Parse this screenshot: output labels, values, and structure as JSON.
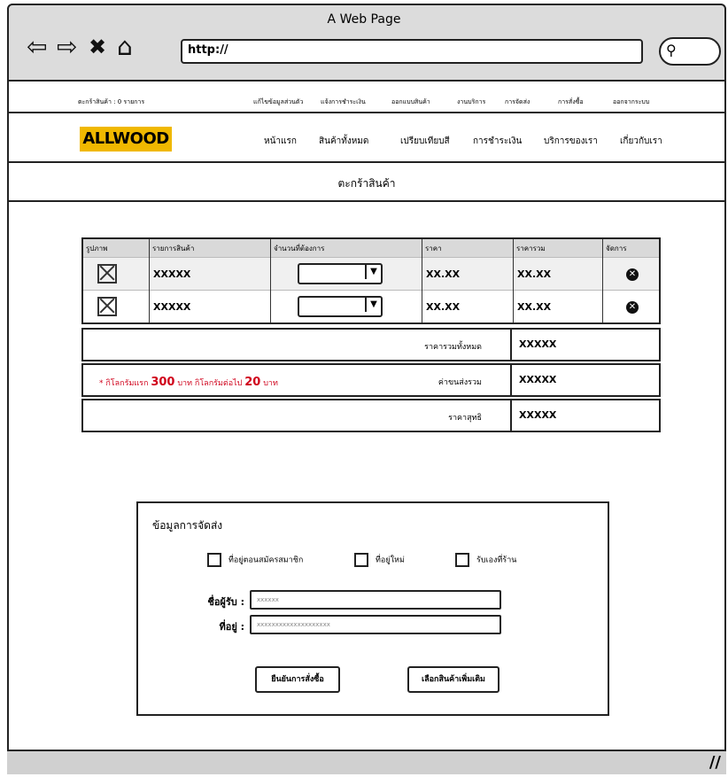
{
  "window": {
    "title": "A Web Page",
    "url": "http://"
  },
  "toplinks": {
    "cart": "ตะกร้าสินค้า : 0 รายการ",
    "items": [
      "แก้ไขข้อมูลส่วนตัว",
      "แจ้งการชำระเงิน",
      "ออกแบบสินค้า",
      "งานบริการ",
      "การจัดส่ง",
      "การสั่งซื้อ",
      "ออกจากระบบ"
    ]
  },
  "brand": {
    "logo": "ALLWOOD"
  },
  "nav": {
    "items": [
      "หน้าแรก",
      "สินค้าทั้งหมด",
      "เปรียบเทียบสี",
      "การชำระเงิน",
      "บริการของเรา",
      "เกี่ยวกับเรา"
    ]
  },
  "page": {
    "heading": "ตะกร้าสินค้า"
  },
  "cart": {
    "headers": [
      "รูปภาพ",
      "รายการสินค้า",
      "จำนวนที่ต้องการ",
      "ราคา",
      "ราคารวม",
      "จัดการ"
    ],
    "rows": [
      {
        "name": "XXXXX",
        "price": "XX.XX",
        "total": "XX.XX"
      },
      {
        "name": "XXXXX",
        "price": "XX.XX",
        "total": "XX.XX"
      }
    ],
    "summary": [
      {
        "label": "ราคารวมทั้งหมด",
        "value": "XXXXX"
      },
      {
        "label": "ค่าขนส่งรวม",
        "value": "XXXXX"
      },
      {
        "label": "ราคาสุทธิ",
        "value": "XXXXX"
      }
    ],
    "shipping_note": {
      "prefix": "* กิโลกรัมแรก ",
      "first": "300",
      "mid": " บาท กิโลกรัมต่อไป ",
      "next": "20",
      "suffix": " บาท"
    }
  },
  "shipping": {
    "title": "ข้อมูลการจัดส่ง",
    "options": [
      "ที่อยู่ตอนสมัครสมาชิก",
      "ที่อยู่ใหม่",
      "รับเองที่ร้าน"
    ],
    "recipient_label": "ชื่อผู้รับ :",
    "recipient_value": "xxxxxx",
    "address_label": "ที่อยู่ :",
    "address_value": "xxxxxxxxxxxxxxxxxxxx",
    "confirm_button": "ยืนยันการสั่งซื้อ",
    "continue_button": "เลือกสินค้าเพิ่มเติม"
  }
}
